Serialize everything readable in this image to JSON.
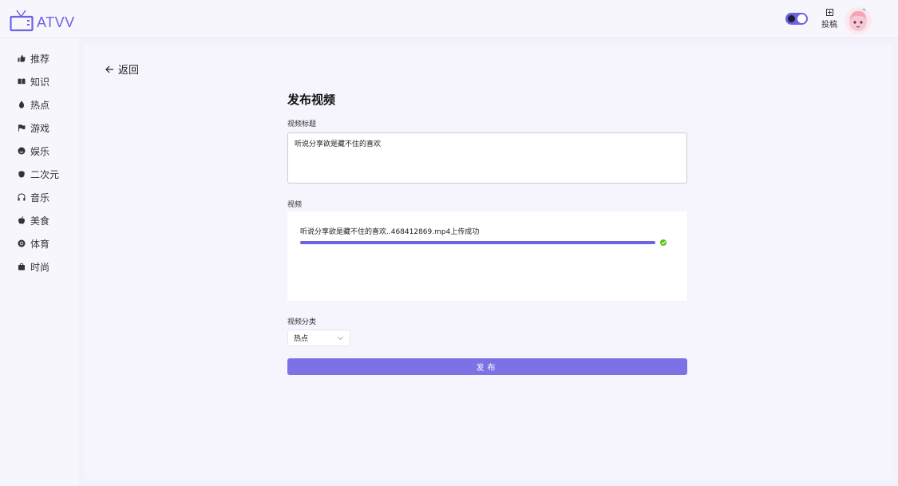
{
  "header": {
    "logo_text": "ATVV",
    "upload_label": "投稿"
  },
  "sidebar": {
    "items": [
      {
        "label": "推荐",
        "icon": "thumbs-up-icon"
      },
      {
        "label": "知识",
        "icon": "book-icon"
      },
      {
        "label": "热点",
        "icon": "fire-icon"
      },
      {
        "label": "游戏",
        "icon": "flag-icon"
      },
      {
        "label": "娱乐",
        "icon": "smile-icon"
      },
      {
        "label": "二次元",
        "icon": "anime-icon"
      },
      {
        "label": "音乐",
        "icon": "headphones-icon"
      },
      {
        "label": "美食",
        "icon": "apple-icon"
      },
      {
        "label": "体育",
        "icon": "ball-icon"
      },
      {
        "label": "时尚",
        "icon": "bag-icon"
      }
    ]
  },
  "main": {
    "back_label": "返回",
    "form_title": "发布视频",
    "title_label": "视频标题",
    "title_value": "听说分享欲是藏不住的喜欢",
    "video_label": "视频",
    "upload_status": "听说分享欲是藏不住的喜欢..468412869.mp4上传成功",
    "upload_progress": 1.0,
    "category_label": "视频分类",
    "category_value": "热点",
    "publish_label": "发布"
  },
  "colors": {
    "accent": "#6b63e0",
    "button": "#7c72e6",
    "success": "#52c41a",
    "background": "#f3f1fb"
  }
}
